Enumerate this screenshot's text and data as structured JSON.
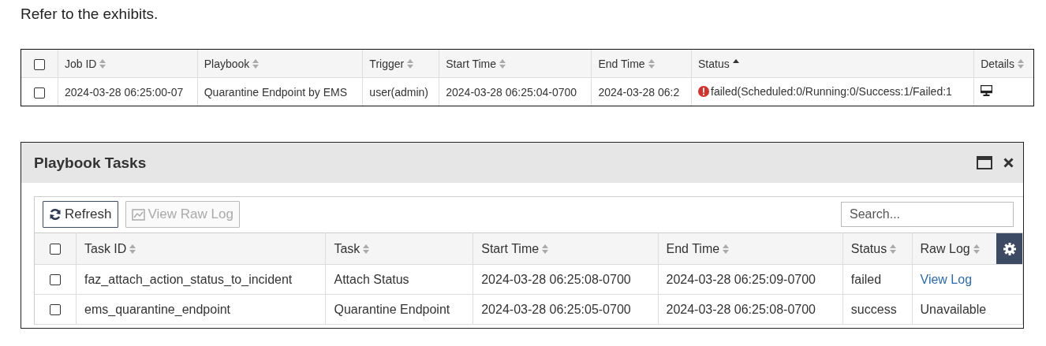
{
  "intro": "Refer to the exhibits.",
  "jobs_table": {
    "select_all_checked": false,
    "columns": [
      {
        "label": "Job ID",
        "sorted": false
      },
      {
        "label": "Playbook",
        "sorted": false
      },
      {
        "label": "Trigger",
        "sorted": false
      },
      {
        "label": "Start Time",
        "sorted": false
      },
      {
        "label": "End Time",
        "sorted": false
      },
      {
        "label": "Status",
        "sorted": true
      },
      {
        "label": "Details",
        "sorted": false
      }
    ],
    "rows": [
      {
        "checked": false,
        "job_id": "2024-03-28 06:25:00-07",
        "playbook": "Quarantine Endpoint by EMS",
        "trigger": "user(admin)",
        "start_time": "2024-03-28 06:25:04-0700",
        "end_time": "2024-03-28 06:2",
        "status": "failed(Scheduled:0/Running:0/Success:1/Failed:1",
        "kind": "failed"
      }
    ]
  },
  "panel": {
    "title": "Playbook Tasks",
    "toolbar": {
      "buttons": [
        {
          "label": "Refresh",
          "kind": "refresh",
          "disabled": false
        },
        {
          "label": "View Raw Log",
          "kind": "chart",
          "disabled": true
        }
      ],
      "search": {
        "placeholder": "Search..."
      }
    },
    "table": {
      "select_all_checked": false,
      "columns": [
        {
          "label": "Task ID",
          "sorted": false
        },
        {
          "label": "Task",
          "sorted": false
        },
        {
          "label": "Start Time",
          "sorted": false
        },
        {
          "label": "End Time",
          "sorted": false
        },
        {
          "label": "Status",
          "sorted": false
        },
        {
          "label": "Raw Log",
          "sorted": false
        }
      ],
      "rows": [
        {
          "checked": false,
          "task_id": "faz_attach_action_status_to_incident",
          "task": "Attach Status",
          "start_time": "2024-03-28 06:25:08-0700",
          "end_time": "2024-03-28 06:25:09-0700",
          "status": "failed",
          "raw_log": "View Log",
          "kind": "link"
        },
        {
          "checked": false,
          "task_id": "ems_quarantine_endpoint",
          "task": "Quarantine Endpoint",
          "start_time": "2024-03-28 06:25:05-0700",
          "end_time": "2024-03-28 06:25:08-0700",
          "status": "success",
          "raw_log": "Unavailable",
          "kind": "text"
        }
      ]
    }
  }
}
